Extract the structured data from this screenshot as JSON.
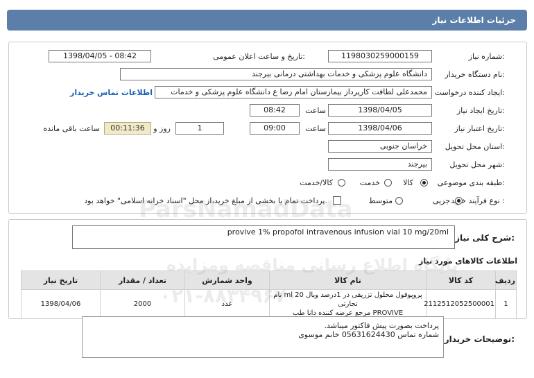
{
  "page_title": "جزئیات اطلاعات نیاز",
  "fields": {
    "need_number_label": "شماره نیاز:",
    "need_number": "1198030259000159",
    "announce_label": "تاریخ و ساعت اعلان عمومی:",
    "announce_value": "1398/04/05 - 08:42",
    "buyer_org_label": "نام دستگاه خریدار:",
    "buyer_org": "دانشگاه علوم پزشکی و خدمات بهداشتی درمانی بیرجند",
    "requester_label": "ایجاد کننده درخواست:",
    "requester": "محمدعلی لطافت کارپرداز بیمارستان امام رضا ع دانشگاه علوم پزشکی و خدمات",
    "contact_link": "اطلاعات تماس خریدار",
    "created_label": "تاریخ ایجاد نیاز:",
    "created_date": "1398/04/05",
    "created_time_label": "ساعت",
    "created_time": "08:42",
    "validity_label": "تاریخ اعتبار نیاز:",
    "validity_date": "1398/04/06",
    "validity_time_label": "ساعت",
    "validity_time": "09:00",
    "days": "1",
    "days_label": "روز و",
    "remaining": "00:11:36",
    "remaining_label": "ساعت باقی مانده",
    "province_label": "استان محل تحویل:",
    "province": "خراسان جنوبی",
    "city_label": "شهر محل تحویل:",
    "city": "بیرجند",
    "category_label": "طبقه بندی موضوعی:",
    "category_options": [
      "کالا",
      "خدمت",
      "کالا/خدمت"
    ],
    "category_selected": "کالا",
    "process_label": "نوع فرآیند خرید :",
    "process_options": [
      "جزیی",
      "متوسط"
    ],
    "process_selected": "جزیی",
    "payment_note": "پرداخت تمام یا بخشی از مبلغ خرید،از محل \"اسناد خزانه اسلامی\" خواهد بود."
  },
  "summary_label": "شرح کلی نیاز:",
  "summary": "provive 1% propofol  intravenous infusion vial 10 mg/20ml",
  "goods_section_title": "اطلاعات کالاهای مورد نیاز",
  "table": {
    "headers": [
      "ردیف",
      "کد کالا",
      "نام کالا",
      "واحد شمارش",
      "تعداد / مقدار",
      "تاریخ نیاز"
    ],
    "rows": [
      {
        "row": "1",
        "code": "2112512052500001",
        "name_line1": "پروپوفول محلول تزریقی در 1درصد ویال 20 ml نام تجارتی",
        "name_line2": "PROVIVE مرجع عرضه کننده دانا طب",
        "unit": "عدد",
        "qty": "2000",
        "date": "1398/04/06"
      }
    ]
  },
  "buyer_notes_label": "توضیحات خریدار:",
  "buyer_notes": [
    "پرداخت بصورت پیش فاکتور میباشد.",
    "شماره تماس 05631624430 خانم موسوی"
  ],
  "watermark": {
    "line1": "ParsNamadData",
    "line2": "پایگاه اطلاع رسانی مناقصه ومزایده",
    "line3": "۰۲۱-۸۸۳۴۹۶۷۰"
  },
  "colors": {
    "title_bar": "#5b7fa8",
    "link": "#1a5fb4",
    "timer_bg": "#f2e9c8"
  }
}
